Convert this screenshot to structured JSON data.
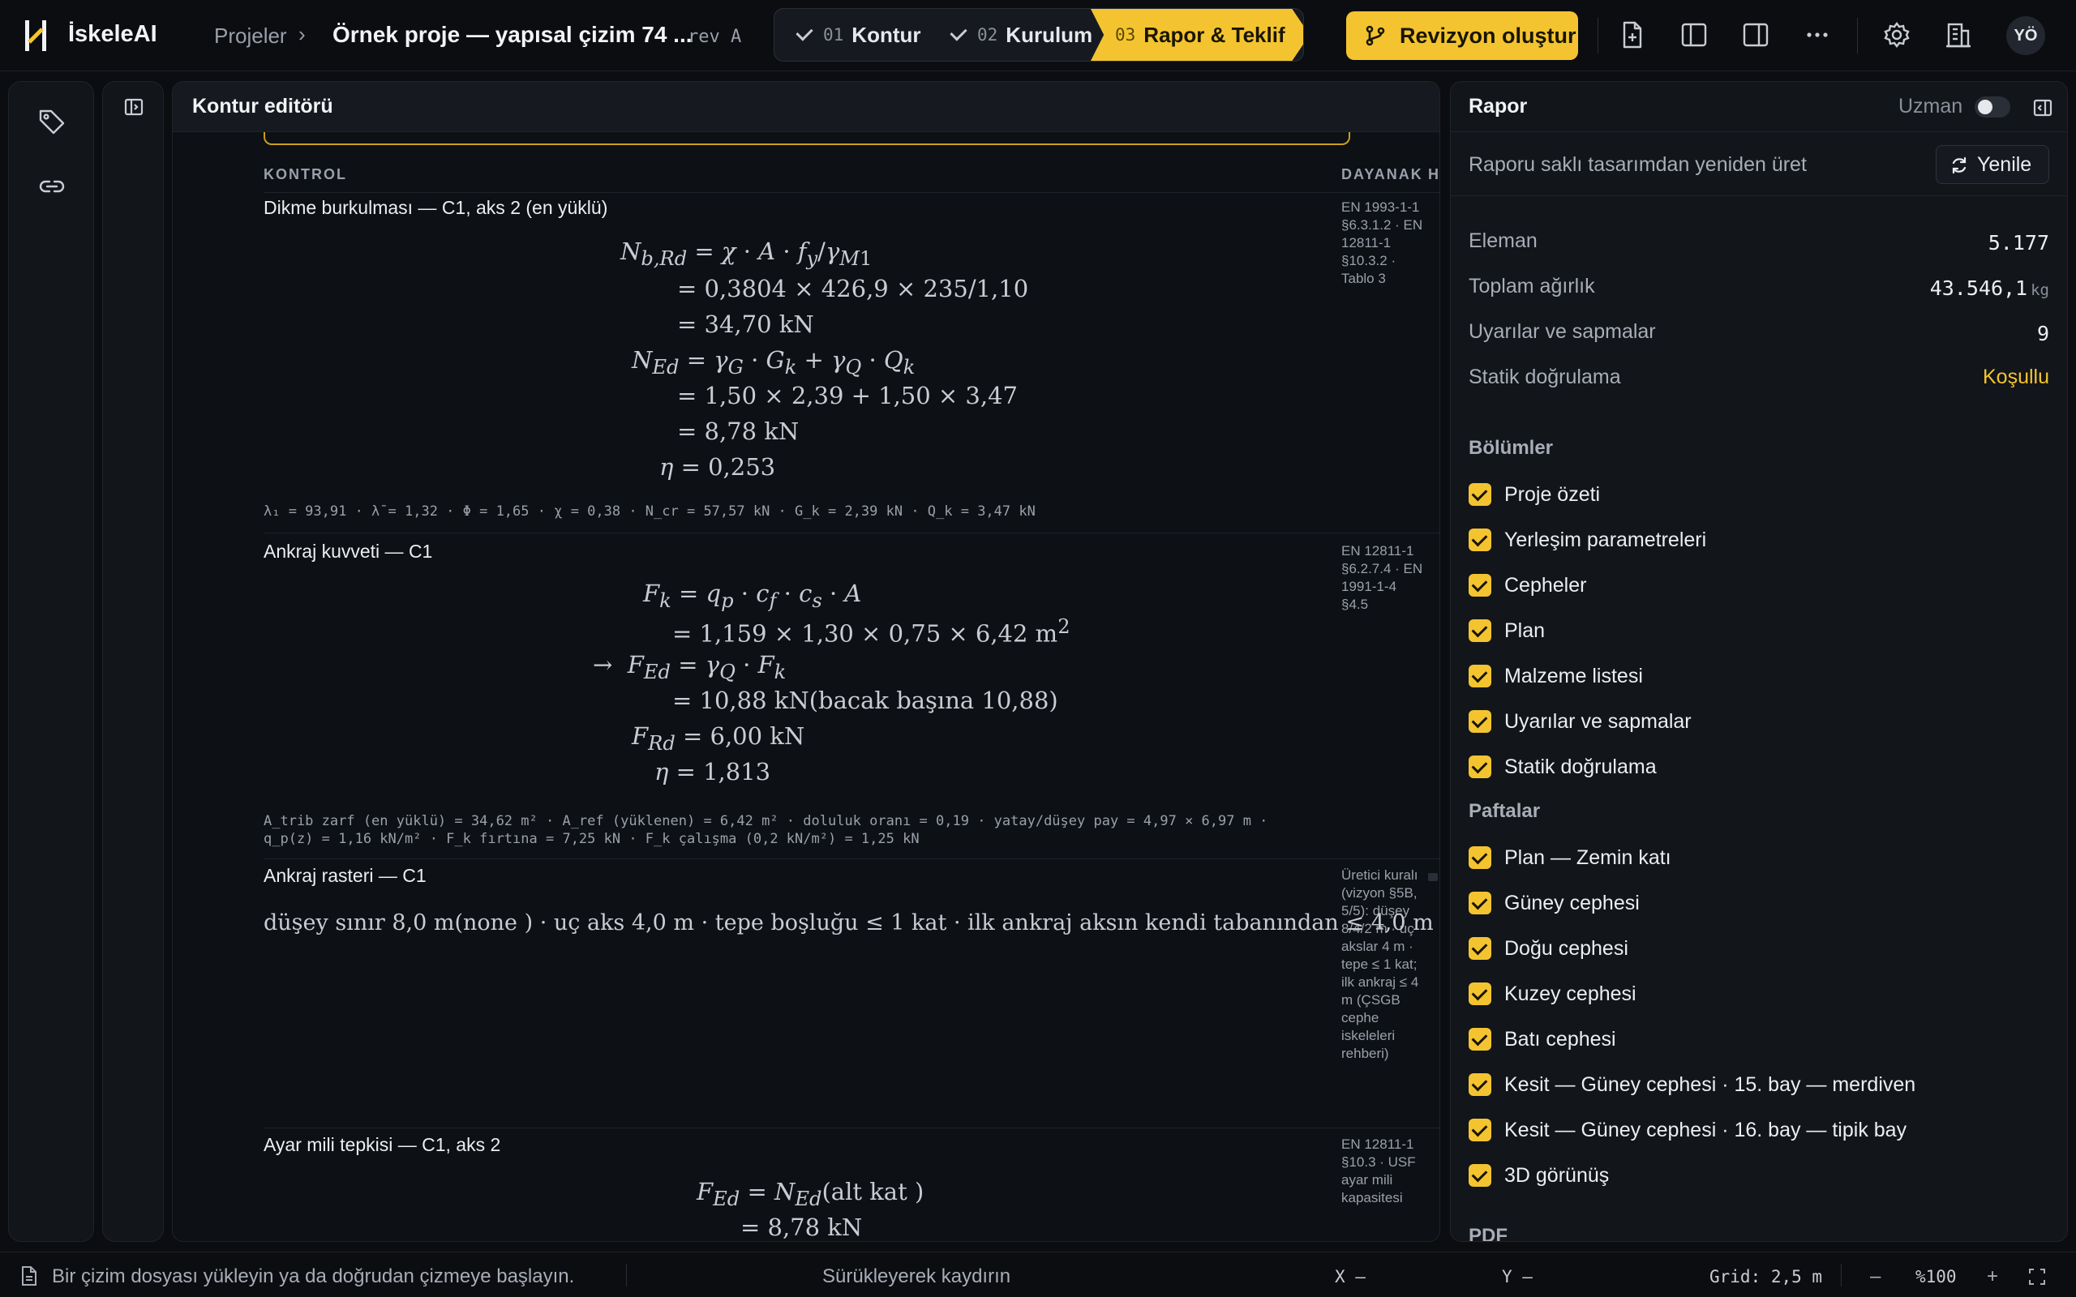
{
  "app": {
    "name": "İskeleAI"
  },
  "breadcrumb": {
    "projects": "Projeler",
    "project_title": "Örnek proje — yapısal çizim 74 ...",
    "revision": "rev A"
  },
  "stepper": [
    {
      "num": "01",
      "label": "Kontur",
      "state": "done"
    },
    {
      "num": "02",
      "label": "Kurulum",
      "state": "done"
    },
    {
      "num": "03",
      "label": "Rapor & Teklif",
      "state": "active"
    }
  ],
  "toolbar": {
    "revision_button": "Revizyon oluştur",
    "avatar": "YÖ"
  },
  "icons": {
    "logo": "scaffold-logo-icon",
    "revision": "branch-icon",
    "new_file": "file-plus-icon",
    "left_panel": "sidebar-left-icon",
    "right_panel": "sidebar-right-icon",
    "more": "more-horizontal-icon",
    "settings": "gear-icon",
    "building": "building-icon",
    "tag": "tag-icon",
    "link": "link-icon",
    "collapse": "collapse-panel-icon",
    "refresh": "refresh-icon",
    "doc": "document-icon"
  },
  "colors": {
    "accent": "#f4c430",
    "warning_text": "#f4c430",
    "bg": "#0b0d11",
    "panel": "#12151a"
  },
  "editor": {
    "title": "Kontur editörü",
    "columns": {
      "check": "KONTROL",
      "basis": "DAYANAK",
      "extra": "H"
    },
    "checks": [
      {
        "title": "Dikme burkulması — C1, aks 2 (en yüklü)",
        "basis": "EN 1993-1-1 §6.3.1.2 · EN 12811-1 §10.3.2 · Tablo 3",
        "meta": "λ₁ = 93,91 · λ̄ = 1,32 · Φ = 1,65 · χ = 0,38 · N_cr = 57,57 kN · G_k = 2,39 kN · Q_k = 3,47 kN"
      },
      {
        "title": "Ankraj kuvveti — C1",
        "basis": "EN 12811-1 §6.2.7.4 · EN 1991-1-4 §4.5",
        "meta1": "A_trib zarf (en yüklü) = 34,62 m² · A_ref (yüklenen) = 6,42 m² · doluluk oranı = 0,19 · yatay/düşey pay = 4,97 × 6,97 m ·",
        "meta2": "q_p(z) = 1,16 kN/m² · F_k fırtına = 7,25 kN · F_k çalışma (0,2 kN/m²) = 1,25 kN"
      },
      {
        "title": "Ankraj rasteri — C1",
        "basis": "Üretici kuralı (vizyon §5B, 5/5): düşey 8/4/2 m · uç akslar 4 m · tepe ≤ 1 kat; ilk ankraj ≤ 4 m (ÇSGB cephe iskeleleri rehberi)",
        "formula": "düşey sınır 8,0 m(none ) ·  uç aks 4,0 m ·  tepe boşluğu  ≤ 1 kat  ·  ilk ankraj aksın kendi tabanından  ≤ 4,0 m"
      },
      {
        "title": "Ayar mili tepkisi — C1, aks 2",
        "basis": "EN 12811-1 §10.3 · USF ayar mili kapasitesi"
      }
    ]
  },
  "report": {
    "title": "Rapor",
    "expert_label": "Uzman",
    "regenerate_label": "Raporu saklı tasarımdan yeniden üret",
    "refresh_button": "Yenile",
    "stats": [
      {
        "label": "Eleman",
        "value": "5.177",
        "unit": ""
      },
      {
        "label": "Toplam ağırlık",
        "value": "43.546,1",
        "unit": "kg"
      },
      {
        "label": "Uyarılar ve sapmalar",
        "value": "9",
        "unit": ""
      },
      {
        "label": "Statik doğrulama",
        "value": "Koşullu",
        "unit": ""
      }
    ],
    "sections_heading": "Bölümler",
    "sections": [
      "Proje özeti",
      "Yerleşim parametreleri",
      "Cepheler",
      "Plan",
      "Malzeme listesi",
      "Uyarılar ve sapmalar",
      "Statik doğrulama"
    ],
    "sheets_heading": "Paftalar",
    "sheets": [
      "Plan — Zemin katı",
      "Güney cephesi",
      "Doğu cephesi",
      "Kuzey cephesi",
      "Batı cephesi",
      "Kesit — Güney cephesi · 15. bay — merdiven",
      "Kesit — Güney cephesi · 16. bay — tipik bay",
      "3D görünüş"
    ],
    "pdf_heading": "PDF"
  },
  "statusbar": {
    "hint": "Bir çizim dosyası yükleyin ya da doğrudan çizmeye başlayın.",
    "drag": "Sürükleyerek kaydırın",
    "x": "X –",
    "y": "Y –",
    "grid": "Grid: 2,5 m",
    "zoom_out": "–",
    "zoom": "%100",
    "zoom_in": "+"
  }
}
